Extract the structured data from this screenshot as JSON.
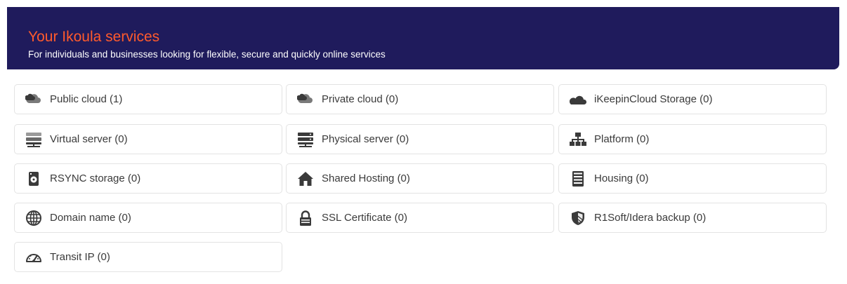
{
  "header": {
    "title": "Your Ikoula services",
    "subtitle": "For individuals and businesses looking for flexible, secure and quickly online services"
  },
  "services": [
    {
      "label": "Public cloud (1)",
      "icon": "cloud-icon"
    },
    {
      "label": "Private cloud (0)",
      "icon": "cloud-icon"
    },
    {
      "label": "iKeepinCloud Storage (0)",
      "icon": "cloud-storage-icon"
    },
    {
      "label": "Virtual server (0)",
      "icon": "virtual-server-icon"
    },
    {
      "label": "Physical server (0)",
      "icon": "server-icon"
    },
    {
      "label": "Platform (0)",
      "icon": "sitemap-icon"
    },
    {
      "label": "RSYNC storage (0)",
      "icon": "hard-drive-icon"
    },
    {
      "label": "Shared Hosting (0)",
      "icon": "home-icon"
    },
    {
      "label": "Housing (0)",
      "icon": "server-rack-icon"
    },
    {
      "label": "Domain name (0)",
      "icon": "globe-icon"
    },
    {
      "label": "SSL Certificate (0)",
      "icon": "lock-icon"
    },
    {
      "label": "R1Soft/Idera backup (0)",
      "icon": "shield-icon"
    },
    {
      "label": "Transit IP (0)",
      "icon": "speedometer-icon"
    }
  ],
  "colors": {
    "header_bg": "#1f1b5c",
    "title": "#ff5a2c",
    "subtitle": "#ffffff",
    "icon": "#3a3a3a"
  }
}
